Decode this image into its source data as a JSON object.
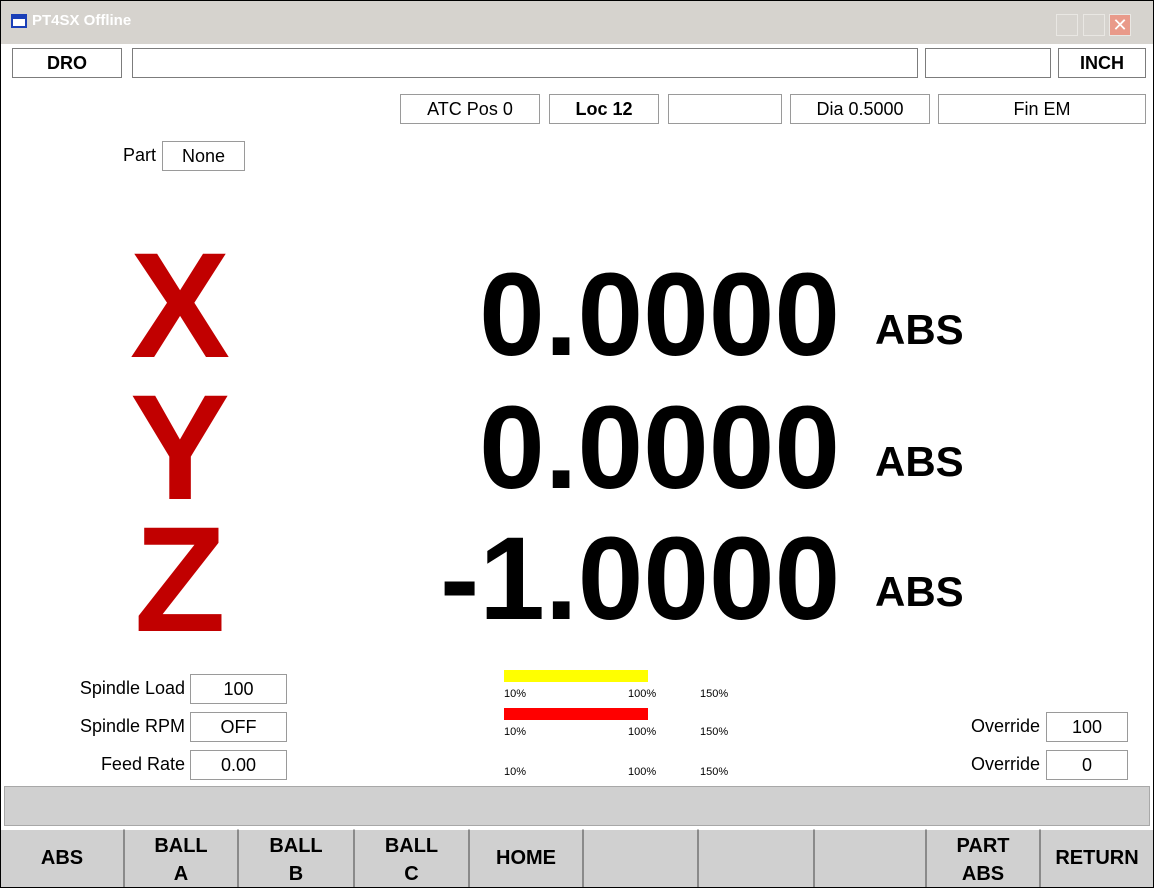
{
  "window": {
    "title": "PT4SX Offline"
  },
  "status": {
    "mode": "DRO",
    "message": "",
    "field2": "",
    "units": "INCH"
  },
  "tool_info": {
    "atc_pos": "ATC Pos 0",
    "loc": "Loc 12",
    "blank": "",
    "dia": "Dia 0.5000",
    "tool": "Fin EM"
  },
  "part": {
    "label": "Part",
    "value": "None"
  },
  "dro": {
    "x": {
      "axis": "X",
      "value": "0.0000",
      "mode": "ABS"
    },
    "y": {
      "axis": "Y",
      "value": "0.0000",
      "mode": "ABS"
    },
    "z": {
      "axis": "Z",
      "value": "-1.0000",
      "mode": "ABS"
    }
  },
  "readouts": {
    "spindle_load": {
      "label": "Spindle Load",
      "value": "100"
    },
    "spindle_rpm": {
      "label": "Spindle RPM",
      "value": "OFF"
    },
    "feed_rate": {
      "label": "Feed Rate",
      "value": "0.00"
    }
  },
  "load_bars": {
    "ticks": [
      "10%",
      "100%",
      "150%"
    ],
    "bars": [
      {
        "name": "spindle-load",
        "color": "#ffff00",
        "level_percent": 100
      },
      {
        "name": "spindle-rpm",
        "color": "#ff0000",
        "level_percent": 100
      },
      {
        "name": "feed-rate",
        "color": "#ffffff",
        "level_percent": 0
      }
    ]
  },
  "overrides": {
    "spindle": {
      "label": "Override",
      "value": "100"
    },
    "feed": {
      "label": "Override",
      "value": "0"
    }
  },
  "message_bar": "",
  "softkeys": [
    {
      "line1": "ABS",
      "line2": ""
    },
    {
      "line1": "BALL",
      "line2": "A"
    },
    {
      "line1": "BALL",
      "line2": "B"
    },
    {
      "line1": "BALL",
      "line2": "C"
    },
    {
      "line1": "HOME",
      "line2": ""
    },
    {
      "line1": "",
      "line2": ""
    },
    {
      "line1": "",
      "line2": ""
    },
    {
      "line1": "",
      "line2": ""
    },
    {
      "line1": "PART",
      "line2": "ABS"
    },
    {
      "line1": "RETURN",
      "line2": ""
    }
  ],
  "colors": {
    "axis_letter": "#c10000",
    "window_border": "#000000"
  }
}
